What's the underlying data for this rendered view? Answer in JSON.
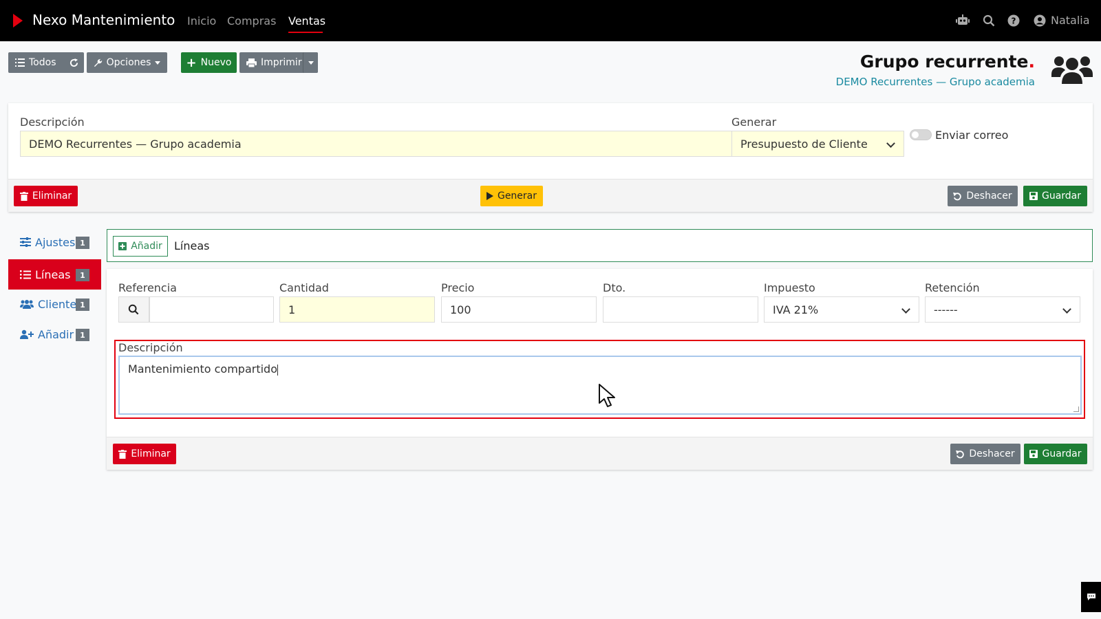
{
  "navbar": {
    "brand": "Nexo Mantenimiento",
    "links": [
      "Inicio",
      "Compras",
      "Ventas"
    ],
    "active_link": "Ventas",
    "user": "Natalia",
    "icons": [
      "robot-icon",
      "search-icon",
      "help-icon",
      "user-icon"
    ]
  },
  "toolbar": {
    "all_label": "Todos",
    "options_label": "Opciones",
    "new_label": "Nuevo",
    "print_label": "Imprimir"
  },
  "header": {
    "title": "Grupo recurrente",
    "title_dot": ".",
    "subtitle": "DEMO Recurrentes — Grupo academia"
  },
  "form": {
    "description_label": "Descripción",
    "description_value": "DEMO Recurrentes — Grupo academia",
    "generate_label": "Generar",
    "generate_value": "Presupuesto de Cliente",
    "send_email_label": "Enviar correo",
    "send_email_on": false,
    "delete_label": "Eliminar",
    "generate_button": "Generar",
    "undo_label": "Deshacer",
    "save_label": "Guardar"
  },
  "sidebar": {
    "items": [
      {
        "label": "Ajustes",
        "count": "1"
      },
      {
        "label": "Líneas",
        "count": "1"
      },
      {
        "label": "Clientes",
        "count": "1"
      },
      {
        "label": "Añadir",
        "count": "1"
      }
    ],
    "active": "Líneas"
  },
  "lines": {
    "add_label": "Añadir",
    "tab_label": "Líneas",
    "reference_label": "Referencia",
    "reference_value": "",
    "quantity_label": "Cantidad",
    "quantity_value": "1",
    "price_label": "Precio",
    "price_value": "100",
    "discount_label": "Dto.",
    "discount_value": "",
    "tax_label": "Impuesto",
    "tax_value": "IVA 21%",
    "retention_label": "Retención",
    "retention_value": "------",
    "description_label": "Descripción",
    "description_value": "Mantenimiento compartido",
    "delete_label": "Eliminar",
    "undo_label": "Deshacer",
    "save_label": "Guardar"
  },
  "colors": {
    "brand_red": "#e3000f",
    "save_green": "#1e7e34",
    "generate_yellow": "#ffc107",
    "input_highlight": "#ffffde",
    "link_blue": "#2a6fb5",
    "subtitle_teal": "#1a8aa0"
  }
}
